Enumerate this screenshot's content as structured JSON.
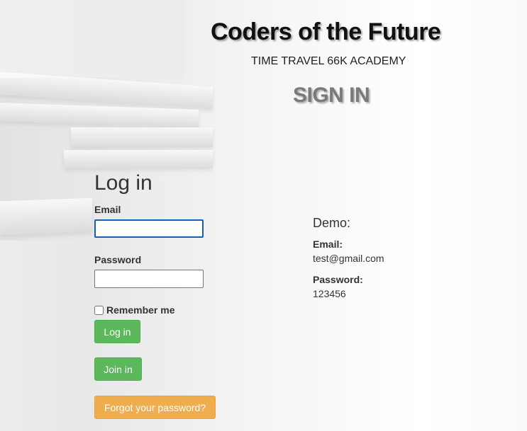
{
  "header": {
    "site_title": "Coders of the Future",
    "subtitle": "TIME TRAVEL 66K ACADEMY",
    "sign_in_heading": "SIGN IN"
  },
  "login": {
    "heading": "Log in",
    "email_label": "Email",
    "email_value": "",
    "password_label": "Password",
    "password_value": "",
    "remember_label": "Remember me",
    "remember_checked": false,
    "login_button": "Log in",
    "join_button": "Join in",
    "forgot_button": "Forgot your password?"
  },
  "demo": {
    "heading": "Demo:",
    "email_label": "Email:",
    "email_value": "test@gmail.com",
    "password_label": "Password:",
    "password_value": "123456"
  },
  "colors": {
    "success": "#5cb85c",
    "warning": "#f0ad4e",
    "focus_border": "#1a5fb4"
  }
}
